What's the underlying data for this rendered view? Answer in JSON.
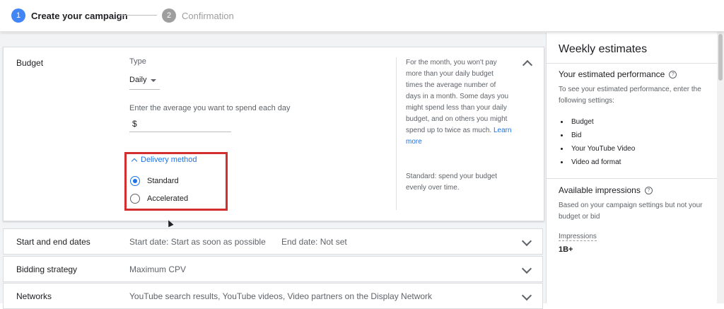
{
  "stepper": {
    "step1": {
      "number": "1",
      "label": "Create your campaign"
    },
    "step2": {
      "number": "2",
      "label": "Confirmation"
    }
  },
  "budget": {
    "title": "Budget",
    "type_label": "Type",
    "type_value": "Daily",
    "amount_prompt": "Enter the average you want to spend each day",
    "currency_symbol": "$",
    "help_text": "For the month, you won't pay more than your daily budget times the average number of days in a month. Some days you might spend less than your daily budget, and on others you might spend up to twice as much.",
    "learn_more": "Learn more",
    "delivery_method_label": "Delivery method",
    "options": [
      {
        "label": "Standard",
        "selected": true
      },
      {
        "label": "Accelerated",
        "selected": false
      }
    ],
    "standard_help": "Standard: spend your budget evenly over time."
  },
  "rows": {
    "dates": {
      "title": "Start and end dates",
      "start": "Start date: Start as soon as possible",
      "end": "End date: Not set"
    },
    "bidding": {
      "title": "Bidding strategy",
      "value": "Maximum CPV"
    },
    "networks": {
      "title": "Networks",
      "value": "YouTube search results, YouTube videos, Video partners on the Display Network"
    }
  },
  "estimates": {
    "title": "Weekly estimates",
    "performance_heading": "Your estimated performance",
    "performance_text": "To see your estimated performance, enter the following settings:",
    "settings": [
      "Budget",
      "Bid",
      "Your YouTube Video",
      "Video ad format"
    ],
    "impressions_heading": "Available impressions",
    "impressions_text": "Based on your campaign settings but not your budget or bid",
    "impressions_label": "Impressions",
    "impressions_value": "1B+"
  },
  "colors": {
    "accent": "#1a73e8",
    "highlight_box": "#d32f2f",
    "step_active": "#4285f4",
    "step_inactive": "#9e9e9e"
  }
}
